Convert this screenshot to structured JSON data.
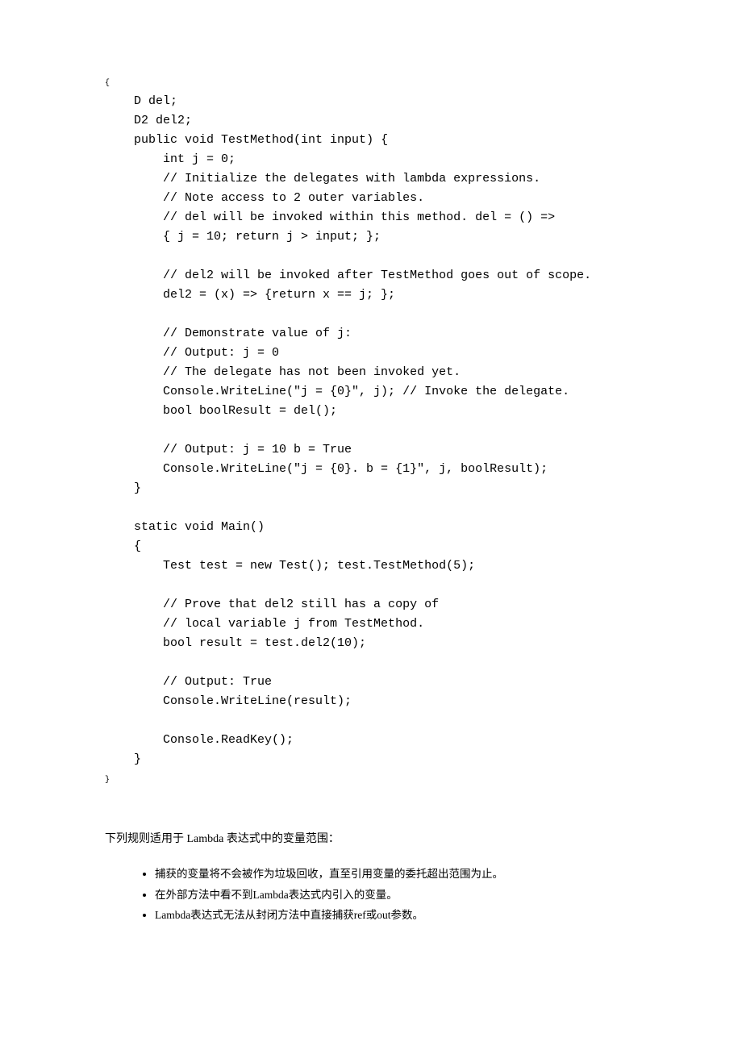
{
  "code": {
    "line0": "{",
    "line1": "    D del;",
    "line2": "    D2 del2;",
    "line3": "    public void TestMethod(int input) {",
    "line4": "        int j = 0;",
    "line5": "        // Initialize the delegates with lambda expressions.",
    "line6": "        // Note access to 2 outer variables.",
    "line7": "        // del will be invoked within this method. del = () =>",
    "line8": "        { j = 10; return j > input; };",
    "line9": "",
    "line10": "        // del2 will be invoked after TestMethod goes out of scope.",
    "line11": "        del2 = (x) => {return x == j; };",
    "line12": "",
    "line13": "        // Demonstrate value of j:",
    "line14": "        // Output: j = 0",
    "line15": "        // The delegate has not been invoked yet.",
    "line16": "        Console.WriteLine(\"j = {0}\", j); // Invoke the delegate.",
    "line17": "        bool boolResult = del();",
    "line18": "",
    "line19": "        // Output: j = 10 b = True",
    "line20": "        Console.WriteLine(\"j = {0}. b = {1}\", j, boolResult);",
    "line21": "    }",
    "line22": "",
    "line23": "    static void Main()",
    "line24": "    {",
    "line25": "        Test test = new Test(); test.TestMethod(5);",
    "line26": "",
    "line27": "        // Prove that del2 still has a copy of",
    "line28": "        // local variable j from TestMethod.",
    "line29": "        bool result = test.del2(10);",
    "line30": "",
    "line31": "        // Output: True",
    "line32": "        Console.WriteLine(result);",
    "line33": "",
    "line34": "        Console.ReadKey();",
    "line35": "    }",
    "line36": "}"
  },
  "paragraph": "下列规则适用于 Lambda 表达式中的变量范围：",
  "bullets": {
    "b1": "捕获的变量将不会被作为垃圾回收，直至引用变量的委托超出范围为止。",
    "b2": "在外部方法中看不到Lambda表达式内引入的变量。",
    "b3": "Lambda表达式无法从封闭方法中直接捕获ref或out参数。"
  }
}
